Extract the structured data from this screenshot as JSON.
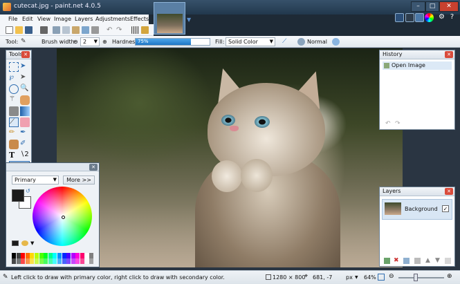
{
  "titlebar": {
    "title": "cutecat.jpg - paint.net 4.0.5"
  },
  "menu": [
    "File",
    "Edit",
    "View",
    "Image",
    "Layers",
    "Adjustments",
    "Effects"
  ],
  "toolbar": {
    "tool_label": "Tool:",
    "brush_width_label": "Brush width:",
    "brush_width_value": "2",
    "hardness_label": "Hardness:",
    "hardness_value": "75%",
    "hardness_percent": 75,
    "fill_label": "Fill:",
    "fill_value": "Solid Color",
    "blend_mode_value": "Normal"
  },
  "panels": {
    "tools_title": "Tools",
    "colors": {
      "mode": "Primary",
      "more_button": "More >>"
    },
    "history": {
      "title": "History",
      "items": [
        "Open Image"
      ]
    },
    "layers": {
      "title": "Layers",
      "items": [
        {
          "name": "Background",
          "visible": true
        }
      ]
    }
  },
  "statusbar": {
    "hint": "Left click to draw with primary color, right click to draw with secondary color.",
    "image_size": "1280 × 800",
    "cursor_position": "681, -7",
    "units": "px",
    "zoom": "64%"
  },
  "colors": {
    "accent": "#1e76c6",
    "titlebar": "#2a4258",
    "primary_color": "#1b1b1b",
    "secondary_color": "#ffffff"
  },
  "palette": [
    "#000000",
    "#404040",
    "#ff0000",
    "#ff6a00",
    "#ffd800",
    "#b6ff00",
    "#4cff00",
    "#00ff21",
    "#00ff90",
    "#00ffff",
    "#0094ff",
    "#0026ff",
    "#4800ff",
    "#b200ff",
    "#ff00dc",
    "#ff006e",
    "#ffffff",
    "#808080"
  ]
}
